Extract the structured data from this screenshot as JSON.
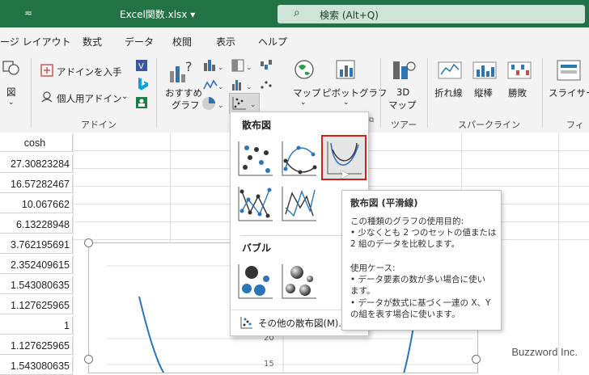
{
  "titlebar": {
    "qa_symbol": "≂",
    "filename": "Excel関数.xlsx  ▾",
    "search_placeholder": "検索 (Alt+Q)"
  },
  "tabs": [
    "ージ レイアウト",
    "数式",
    "データ",
    "校閲",
    "表示",
    "ヘルプ"
  ],
  "ribbon": {
    "addin_get": "アドインを入手",
    "addin_personal": "個人用アドイン",
    "group_addin": "アドイン",
    "recommended_line1": "おすすめ",
    "recommended_line2": "グラフ",
    "map": "マップ",
    "pivot_chart": "ピボットグラフ",
    "map3d_line1": "3D",
    "map3d_line2": "マップ",
    "group_tour": "ツアー",
    "spark_line": "折れ線",
    "spark_column": "縦棒",
    "spark_winloss": "勝敗",
    "group_sparkline": "スパークライン",
    "slicer": "スライサー",
    "group_filter": "フィル",
    "left_partial": "図"
  },
  "sheet": {
    "header": "cosh",
    "values": [
      "27.30823284",
      "16.57282467",
      "10.067662",
      "6.13228948",
      "3.762195691",
      "2.352409615",
      "1.543080635",
      "1.127625965",
      "1",
      "1.127625965",
      "1.543080635"
    ]
  },
  "chart": {
    "ytick_20": "20",
    "ytick_15": "15"
  },
  "dropdown": {
    "scatter_header": "散布図",
    "bubble_header": "バブル",
    "more_scatter": "その他の散布図(M)..."
  },
  "tooltip": {
    "title": "散布図 (平滑線)",
    "line1": "この種類のグラフの使用目的:",
    "line2": "• 少なくとも 2 つのセットの値または",
    "line3": "2 組のデータを比較します。",
    "line4": "使用ケース:",
    "line5": "• データ要素の数が多い場合に使い",
    "line6": "ます。",
    "line7": "• データが数式に基づく一連の X、Y",
    "line8": "の組を表す場合に使います。"
  },
  "watermark": "Buzzword Inc.",
  "colors": {
    "excel_green": "#217346",
    "highlight_red": "#d21f1f",
    "series_blue": "#2e75b6"
  }
}
